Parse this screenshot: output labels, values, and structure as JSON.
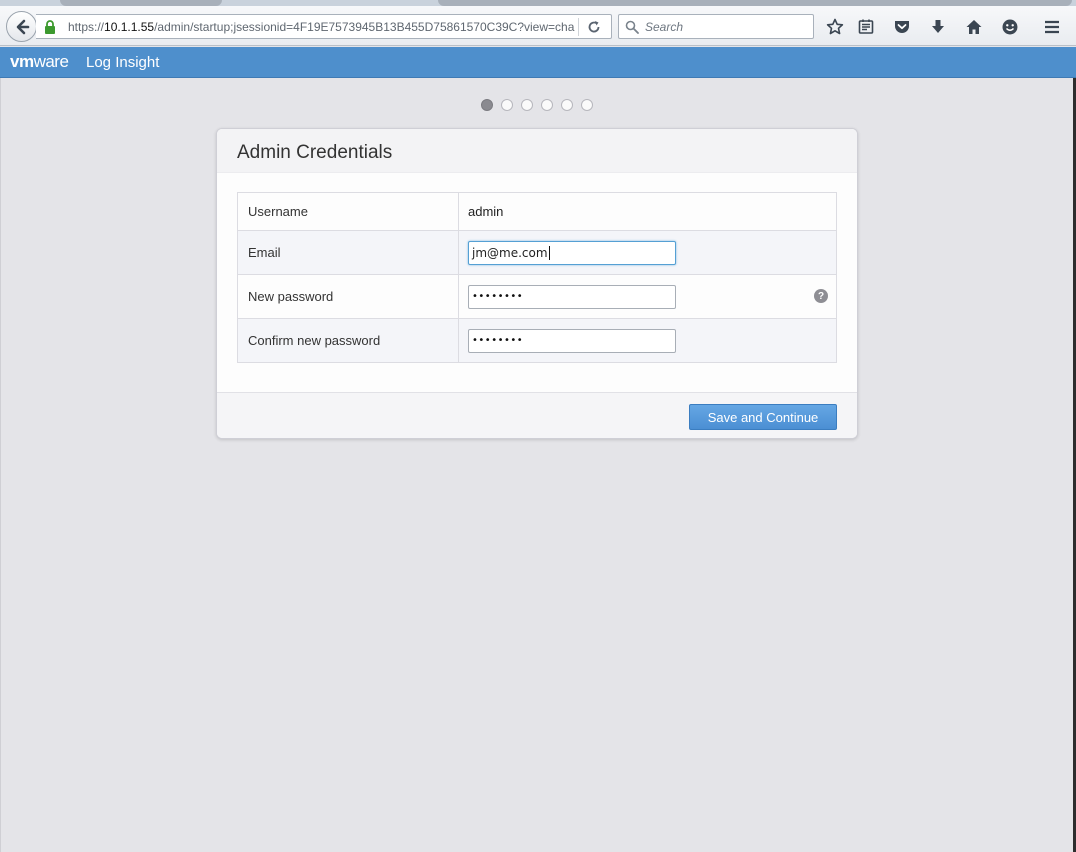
{
  "browser": {
    "url_prefix": "https://",
    "url_host": "10.1.1.55",
    "url_path": "/admin/startup;jsessionid=4F19E7573945B13B455D75861570C39C?view=cha",
    "search_placeholder": "Search"
  },
  "header": {
    "brand_vm": "vm",
    "brand_ware": "ware",
    "product_name": "Log Insight"
  },
  "stepper": {
    "total_steps": 6,
    "current_step": 1
  },
  "card": {
    "title": "Admin Credentials",
    "rows": [
      {
        "label": "Username",
        "value": "admin"
      },
      {
        "label": "Email",
        "value": "jm@me.com"
      },
      {
        "label": "New password",
        "value": "••••••••"
      },
      {
        "label": "Confirm new password",
        "value": "••••••••"
      }
    ],
    "help_glyph": "?",
    "save_label": "Save and Continue"
  }
}
